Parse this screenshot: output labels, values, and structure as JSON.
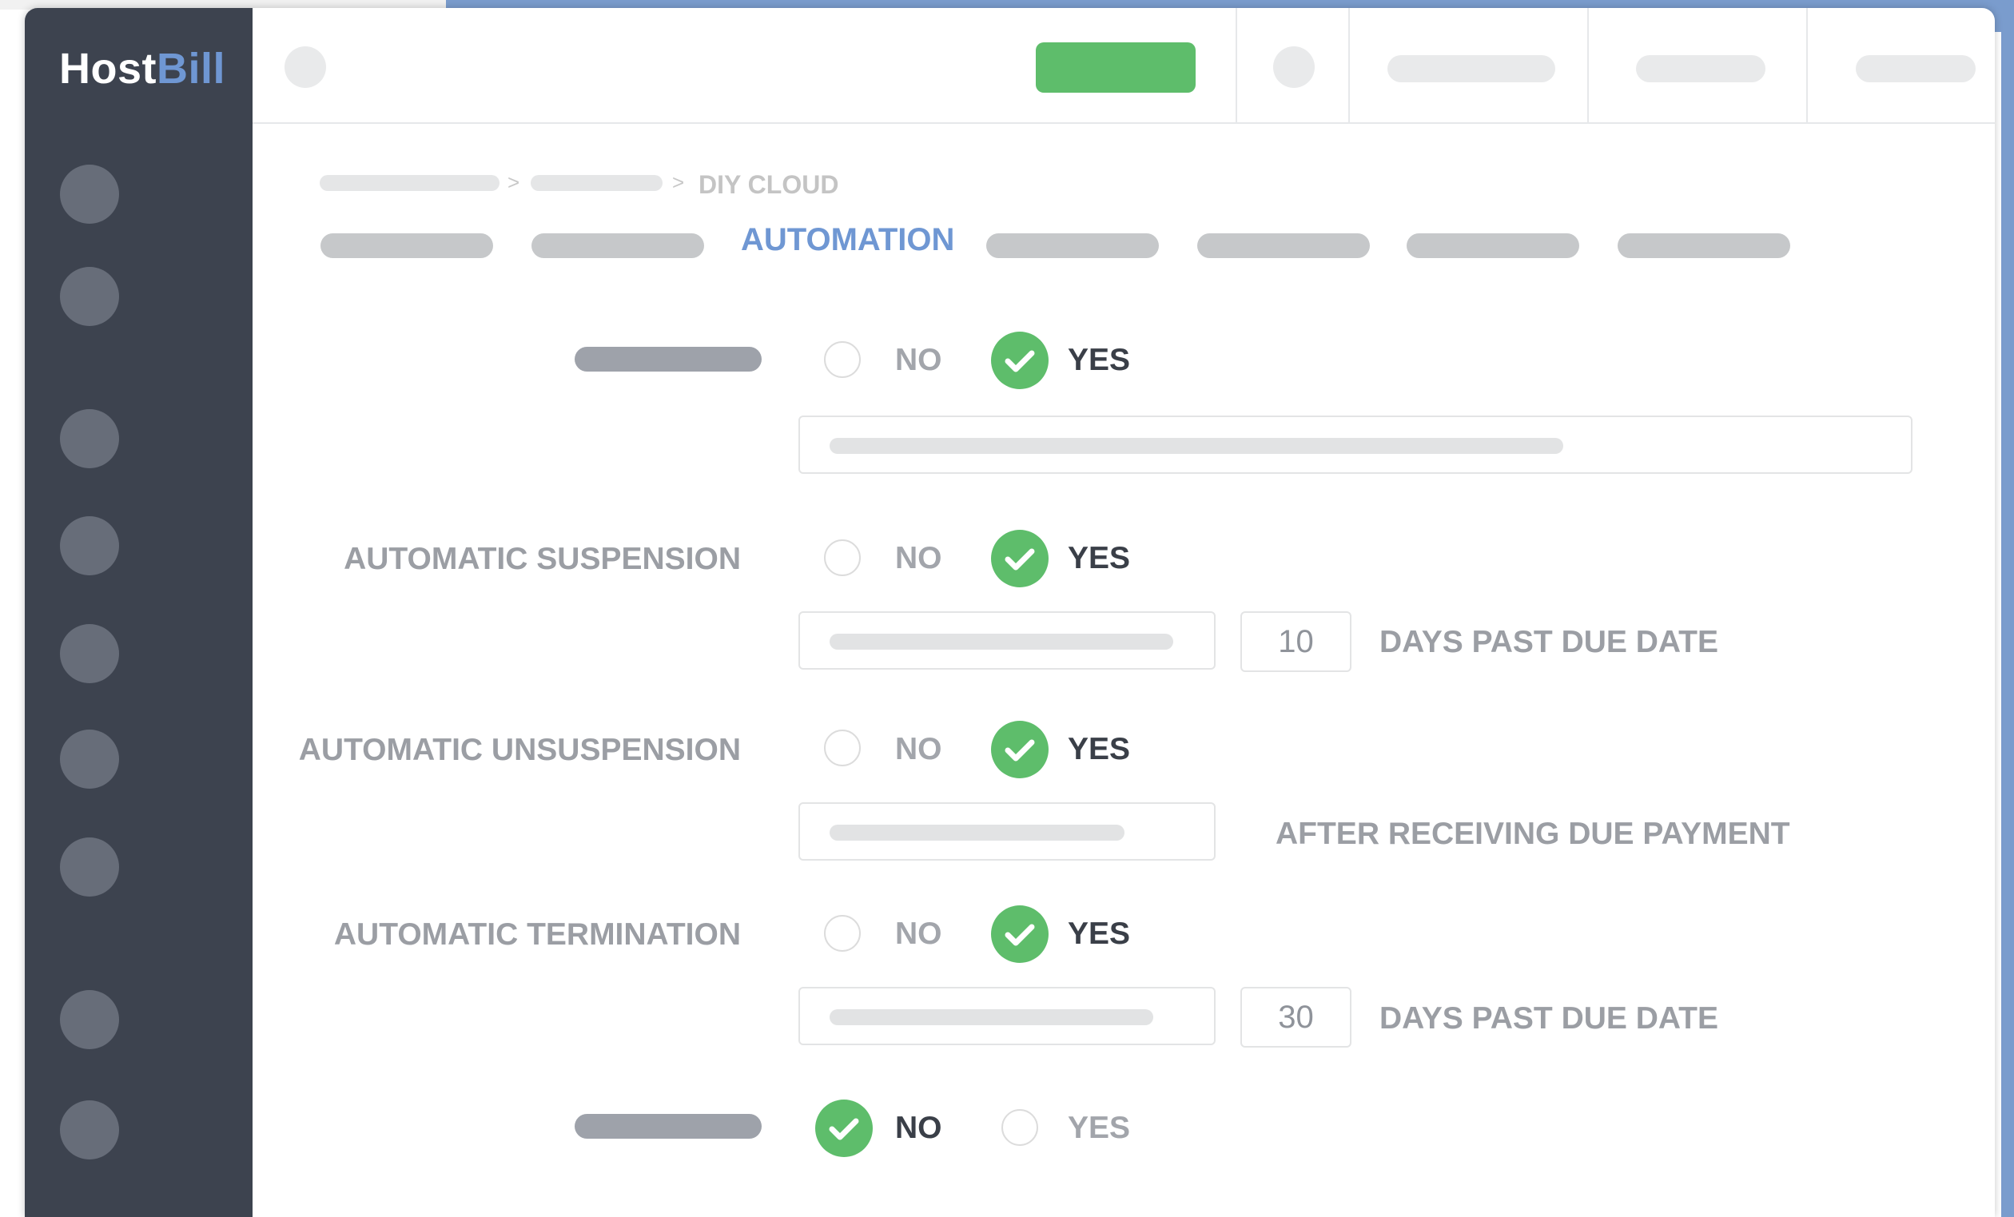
{
  "logo": {
    "part1": "Host",
    "part2": "Bill"
  },
  "breadcrumb": {
    "current": "DIY CLOUD"
  },
  "tabs": {
    "active_label": "AUTOMATION"
  },
  "options": {
    "no": "NO",
    "yes": "YES"
  },
  "settings": [
    {
      "label": "",
      "selected": "yes"
    },
    {
      "label": "AUTOMATIC SUSPENSION",
      "selected": "yes",
      "days": "10",
      "suffix": "DAYS PAST DUE DATE"
    },
    {
      "label": "AUTOMATIC UNSUSPENSION",
      "selected": "yes",
      "suffix": "AFTER RECEIVING DUE PAYMENT"
    },
    {
      "label": "AUTOMATIC TERMINATION",
      "selected": "yes",
      "days": "30",
      "suffix": "DAYS PAST DUE DATE"
    },
    {
      "label": "",
      "selected": "no"
    }
  ],
  "colors": {
    "sidebar": "#3d434f",
    "accent_blue": "#6f97d3",
    "check_green": "#5ebd6b",
    "backdrop_blue": "#7a9ccd"
  },
  "icons": {
    "selected_radio": "check-circle-icon",
    "unselected_radio": "empty-circle-icon",
    "separator": "chevron-right-icon"
  }
}
